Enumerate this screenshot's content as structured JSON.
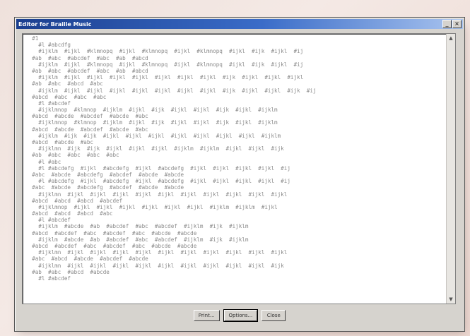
{
  "window": {
    "title": "Editor for Braille Music",
    "minimize_glyph": "_",
    "close_glyph": "×"
  },
  "editor": {
    "lines": [
      "  #1",
      "    #l #abcdfg",
      "    #ijklm  #ijkl  #klmnopq  #ijkl  #klmnopq  #ijkl  #klmnopq  #ijkl  #ijk  #ijkl  #ij",
      "  #ab  #abc  #abcdef  #abc  #ab  #abcd",
      "    #ijklm  #ijkl  #klmnopq  #ijkl  #klmnopq  #ijkl  #klmnopq  #ijkl  #ijk  #ijkl  #ij",
      "  #ab  #abc  #abcdef  #abc  #ab  #abcd",
      "    #ijklm  #ijkl  #ijkl  #ijkl  #ijkl  #ijkl  #ijkl  #ijkl  #ijk  #ijkl  #ijkl  #ijkl",
      "  #ab  #abc  #abcd  #abc",
      "    #ijklm  #ijkl  #ijkl  #ijkl  #ijkl  #ijkl  #ijkl  #ijkl  #ijk  #ijkl  #ijkl  #ijk  #ij",
      "  #abcd  #abc  #abc  #abc",
      "    #l #abcdef",
      "    #ijklmnop  #klmnop  #ijklm  #ijkl  #ijk  #ijkl  #ijkl  #ijk  #ijkl  #ijklm",
      "  #abcd  #abcde  #abcdef  #abcde  #abc",
      "    #ijklmnop  #klmnop  #ijklm  #ijkl  #ijk  #ijkl  #ijkl  #ijk  #ijkl  #ijklm",
      "  #abcd  #abcde  #abcdef  #abcde  #abc",
      "    #ijklm  #ijk  #ijk  #ijkl  #ijkl  #ijkl  #ijkl  #ijkl  #ijkl  #ijkl  #ijklm",
      "  #abcd  #abcde  #abc",
      "    #ijklmn  #ijk  #ijk  #ijkl  #ijkl  #ijkl  #ijklm  #ijklm  #ijkl  #ijkl  #ijk",
      "  #ab  #abc  #abc  #abc  #abc",
      "    #l #abc",
      "    #l #abcdefg  #ijkl  #abcdefg  #ijkl  #abcdefg  #ijkl  #ijkl  #ijkl  #ijkl  #ij",
      "  #abc  #abcde  #abcdefg  #abcdef  #abcde  #abcde",
      "    #l #abcdefg  #ijkl  #abcdefg  #ijkl  #abcdefg  #ijkl  #ijkl  #ijkl  #ijkl  #ij",
      "  #abc  #abcde  #abcdefg  #abcdef  #abcde  #abcde",
      "    #ijklmn  #ijkl  #ijkl  #ijkl  #ijkl  #ijkl  #ijkl  #ijkl  #ijkl  #ijkl  #ijkl",
      "  #abcd  #abcd  #abcd  #abcdef",
      "    #ijklmnop  #ijkl  #ijkl  #ijkl  #ijkl  #ijkl  #ijkl  #ijklm  #ijklm  #ijkl",
      "  #abcd  #abcd  #abcd  #abc",
      "    #l #abcdef",
      "    #ijklm  #abcde  #ab  #abcdef  #abc  #abcdef  #ijklm  #ijk  #ijklm",
      "  #abcd  #abcdef  #abc  #abcdef  #abc  #abcde  #abcde",
      "    #ijklm  #abcde  #ab  #abcdef  #abc  #abcdef  #ijklm  #ijk  #ijklm",
      "  #abcd  #abcdef  #abc  #abcdef  #abc  #abcde  #abcde",
      "    #ijklmn  #ijkl  #ijkl  #ijkl  #ijkl  #ijkl  #ijkl  #ijkl  #ijkl  #ijkl  #ijkl",
      "  #abc  #abcd  #abcde  #abcdef  #abcde",
      "    #ijklmn  #ijkl  #ijkl  #ijkl  #ijkl  #ijkl  #ijkl  #ijkl  #ijkl  #ijkl  #ijk",
      "  #ab  #abc  #abcd  #abcde",
      "    #l #abcdef"
    ]
  },
  "buttons": {
    "print_label": "Print...",
    "options_label": "Options...",
    "close_label": "Close"
  }
}
